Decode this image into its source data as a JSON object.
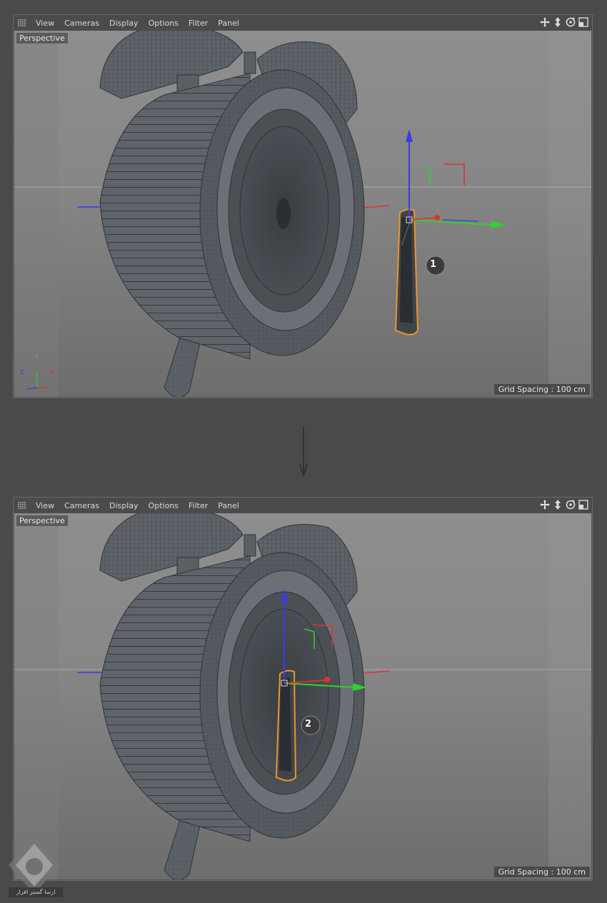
{
  "menu": [
    "View",
    "Cameras",
    "Display",
    "Options",
    "Filter",
    "Panel"
  ],
  "viewport_label": "Perspective",
  "grid_spacing": "Grid Spacing : 100 cm",
  "nav_icons": [
    "move-view-icon",
    "dolly-view-icon",
    "rotate-view-icon",
    "toggle-layout-icon"
  ],
  "axis_labels": {
    "y": "Y",
    "z": "Z",
    "x": "X"
  },
  "steps": {
    "first": "1",
    "second": "2"
  },
  "colors": {
    "selection": "#e8952e",
    "axis_x": "#e23030",
    "axis_y": "#30d030",
    "axis_z": "#3a3ae8"
  },
  "watermark_text": "ارسا گستر افزار"
}
